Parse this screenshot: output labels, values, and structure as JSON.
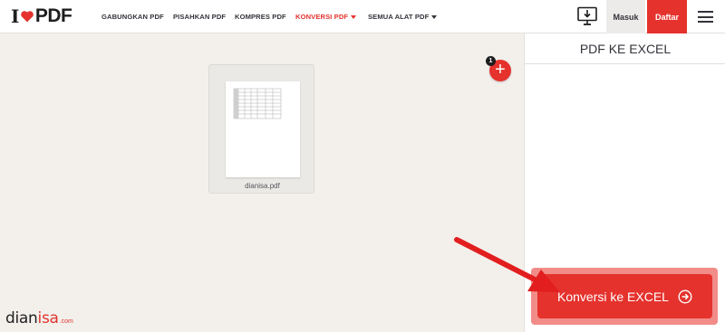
{
  "logo": {
    "prefix": "I",
    "suffix": "PDF"
  },
  "nav": {
    "items": [
      {
        "label": "GABUNGKAN PDF"
      },
      {
        "label": "PISAHKAN PDF"
      },
      {
        "label": "KOMPRES PDF"
      },
      {
        "label": "KONVERSI PDF"
      },
      {
        "label": "SEMUA ALAT PDF"
      }
    ]
  },
  "header": {
    "login_label": "Masuk",
    "signup_label": "Daftar"
  },
  "sidebar": {
    "title": "PDF KE EXCEL"
  },
  "file": {
    "name": "dianisa.pdf"
  },
  "add_files": {
    "count": "1",
    "symbol": "+"
  },
  "convert": {
    "label": "Konversi ke EXCEL"
  },
  "watermark": {
    "part1": "dian",
    "part2": "isa",
    "domain": ".com"
  },
  "colors": {
    "brand": "#e5322d",
    "background": "#f3f0ec",
    "text": "#33333b"
  }
}
